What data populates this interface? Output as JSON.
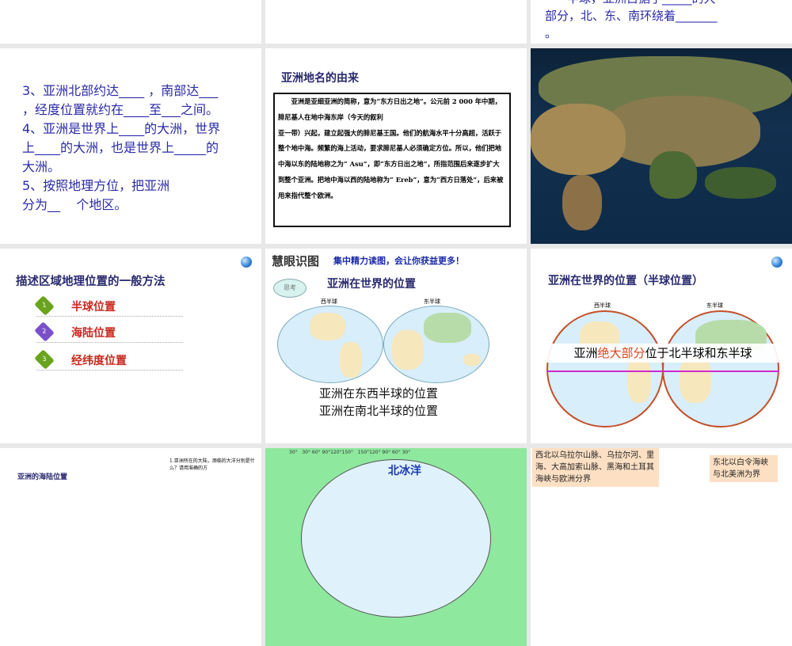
{
  "slides": {
    "top_right": {
      "line1": "半球，亚洲占据了_____的大",
      "line2": "部分，北、东、南环绕着_______",
      "line3": "。"
    },
    "questions": {
      "lines": [
        "3、亚洲北部约达____ ，南部达___",
        "，经度位置就约在____至___之间。",
        "4、亚洲是世界上____的大洲，世界",
        "上____的大洲，也是世界上_____的",
        "大洲。",
        "5、按照地理方位，把亚洲",
        "分为__    个地区。"
      ]
    },
    "origin": {
      "title": "亚洲地名的由来",
      "text": "　　亚洲是亚细亚洲的简称，意为“东方日出之地”。公元前 2 000 年中期，腓尼基人在地中海东岸（今天的叙利\n亚一带）兴起，建立起强大的腓尼基王国。他们的航海水平十分高超，活跃于整个地中海。频繁的海上活动，要求腓尼基人必须确定方位。所以，他们把地中海以东的陆地称之为“ Asu”，即“东方日出之地”，所指范围后来逐步扩大到整个亚洲。把地中海以西的陆地称为“ Ereb”，意为“西方日落处”，后来被用来指代整个欧洲。"
    },
    "methods": {
      "title": "描述区域地理位置的一般方法",
      "items": [
        {
          "num": "1",
          "label": "半球位置",
          "color": "#6aa41e"
        },
        {
          "num": "2",
          "label": "海陆位置",
          "color": "#7b4fc9"
        },
        {
          "num": "3",
          "label": "经纬度位置",
          "color": "#6aa41e"
        }
      ]
    },
    "world": {
      "logo": "慧眼识图",
      "slogan": "集中精力读图，会让你获益更多！",
      "bubble": "思考",
      "title": "亚洲在世界的位置",
      "west": "西半球",
      "east": "东半球",
      "line1": "亚洲在东西半球的位置",
      "line2": "亚洲在南北半球的位置"
    },
    "hemi": {
      "title": "亚洲在世界的位置（半球位置）",
      "west": "西半球",
      "east": "东半球",
      "caption_pre": "亚洲",
      "caption_hl": "绝大部分",
      "caption_post": "位于北半球和东半球"
    },
    "sealand": {
      "title": "亚洲的海陆位置",
      "question": "1.亚洲所在的大陆，濒临的大洋分别是什么？请用准确的方"
    },
    "arctic": {
      "ticks": "30°   30° 60° 90°120°150°   150°120° 90° 60° 30°",
      "ocean": "北冰洋"
    },
    "borders": {
      "nw": "西北以乌拉尔山脉、乌拉尔河、里海、大高加索山脉、黑海和土耳其海峡与欧洲分界",
      "ne": "东北以白令海峡与北美洲为界"
    }
  }
}
